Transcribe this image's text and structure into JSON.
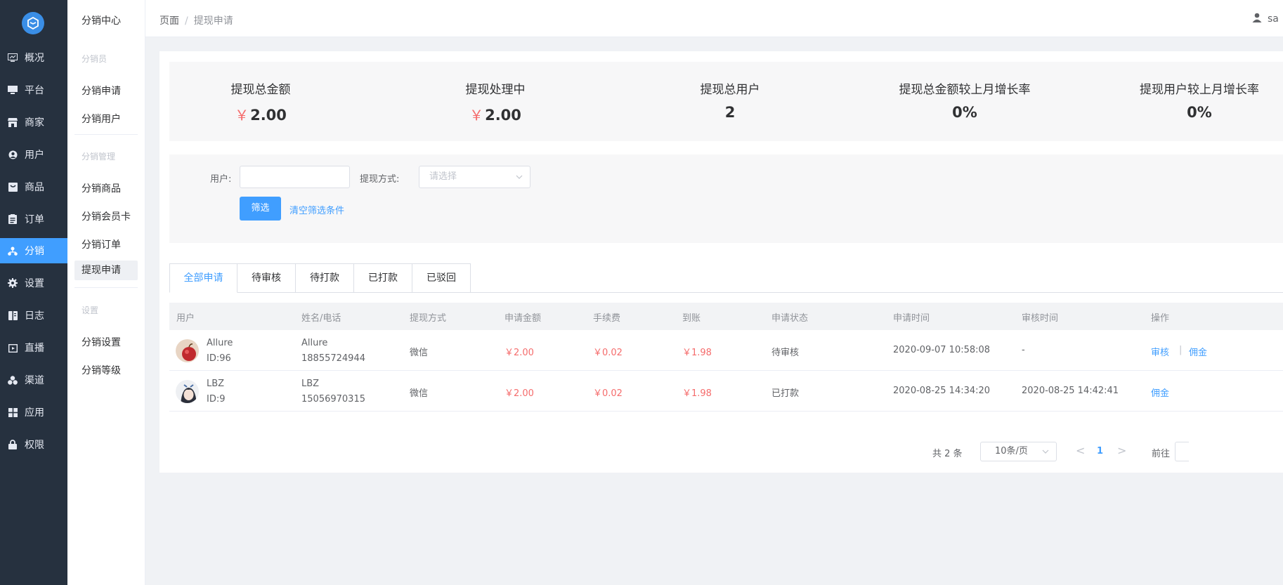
{
  "rail": {
    "items": [
      {
        "label": "概况",
        "icon": "dashboard-icon"
      },
      {
        "label": "平台",
        "icon": "monitor-icon"
      },
      {
        "label": "商家",
        "icon": "store-icon"
      },
      {
        "label": "用户",
        "icon": "user-icon"
      },
      {
        "label": "商品",
        "icon": "goods-icon"
      },
      {
        "label": "订单",
        "icon": "order-icon"
      },
      {
        "label": "分销",
        "icon": "distribution-icon"
      },
      {
        "label": "设置",
        "icon": "gear-icon"
      },
      {
        "label": "日志",
        "icon": "log-icon"
      },
      {
        "label": "直播",
        "icon": "live-icon"
      },
      {
        "label": "渠道",
        "icon": "channel-icon"
      },
      {
        "label": "应用",
        "icon": "apps-icon"
      },
      {
        "label": "权限",
        "icon": "lock-icon"
      }
    ],
    "active": "分销"
  },
  "submenu": {
    "title": "分销中心",
    "groups": [
      {
        "title": "分销员",
        "items": [
          "分销申请",
          "分销用户"
        ]
      },
      {
        "title": "分销管理",
        "items": [
          "分销商品",
          "分销会员卡",
          "分销订单",
          "提现申请"
        ]
      },
      {
        "title": "设置",
        "items": [
          "分销设置",
          "分销等级"
        ]
      }
    ],
    "active": "提现申请"
  },
  "breadcrumb": {
    "root": "页面",
    "sep": "/",
    "current": "提现申请"
  },
  "user": {
    "name": "sa"
  },
  "stats": [
    {
      "label": "提现总金额",
      "currency": "￥",
      "value": "2.00"
    },
    {
      "label": "提现处理中",
      "currency": "￥",
      "value": "2.00"
    },
    {
      "label": "提现总用户",
      "currency": "",
      "value": "2"
    },
    {
      "label": "提现总金额较上月增长率",
      "currency": "",
      "value": "0%"
    },
    {
      "label": "提现用户较上月增长率",
      "currency": "",
      "value": "0%"
    }
  ],
  "filter": {
    "user_label": "用户:",
    "user_value": "",
    "method_label": "提现方式:",
    "method_placeholder": "请选择",
    "submit": "筛选",
    "clear": "清空筛选条件"
  },
  "tabs": [
    "全部申请",
    "待审核",
    "待打款",
    "已打款",
    "已驳回"
  ],
  "active_tab": "全部申请",
  "table": {
    "headers": [
      "用户",
      "姓名/电话",
      "提现方式",
      "申请金额",
      "手续费",
      "到账",
      "申请状态",
      "申请时间",
      "审核时间",
      "操作"
    ],
    "rows": [
      {
        "nick": "Allure",
        "uid": "ID:96",
        "name": "Allure",
        "phone": "18855724944",
        "method": "微信",
        "amount": "￥2.00",
        "fee": "￥0.02",
        "received": "￥1.98",
        "status": "待审核",
        "apply_time": "2020-09-07 10:58:08",
        "audit_time": "-",
        "actions": [
          "审核",
          "|",
          "佣金"
        ]
      },
      {
        "nick": "LBZ",
        "uid": "ID:9",
        "name": "LBZ",
        "phone": "15056970315",
        "method": "微信",
        "amount": "￥2.00",
        "fee": "￥0.02",
        "received": "￥1.98",
        "status": "已打款",
        "apply_time": "2020-08-25 14:34:20",
        "audit_time": "2020-08-25 14:42:41",
        "actions": [
          "佣金"
        ]
      }
    ]
  },
  "pagination": {
    "total": "共 2 条",
    "page_size": "10条/页",
    "prev": "<",
    "page": "1",
    "next": ">",
    "goto": "前往"
  }
}
